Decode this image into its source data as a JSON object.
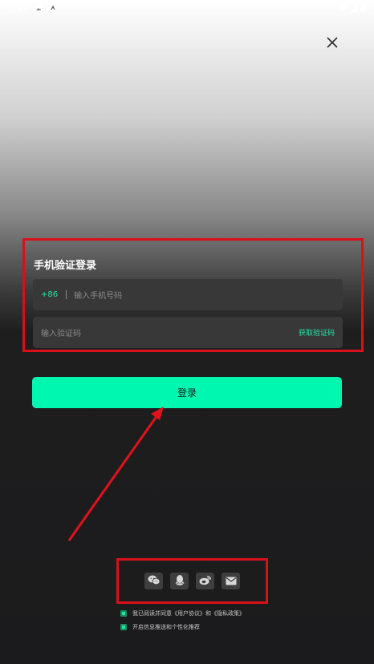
{
  "status_bar": {
    "time": "2:53",
    "left_icons": [
      "image-icon",
      "app-notification-icon"
    ],
    "right_icons": [
      "wifi-icon",
      "signal-icon",
      "battery-icon"
    ]
  },
  "close": {
    "icon": "close-icon"
  },
  "login_form": {
    "title": "手机验证登录",
    "country_code": "+86",
    "phone_placeholder": "输入手机号码",
    "code_placeholder": "输入验证码",
    "get_code_label": "获取验证码"
  },
  "login_button": {
    "label": "登录"
  },
  "social_login": {
    "icons": [
      "wechat-icon",
      "qq-icon",
      "weibo-icon",
      "email-icon"
    ]
  },
  "agreements": {
    "terms_text": "我已阅读并同意《用户协议》和《隐私政策》",
    "push_text": "开启信息推送和个性化推荐"
  },
  "colors": {
    "accent": "#00f7b0",
    "accent_text": "#22e3a8",
    "highlight_box": "#d8101a",
    "field_bg": "#383838"
  }
}
